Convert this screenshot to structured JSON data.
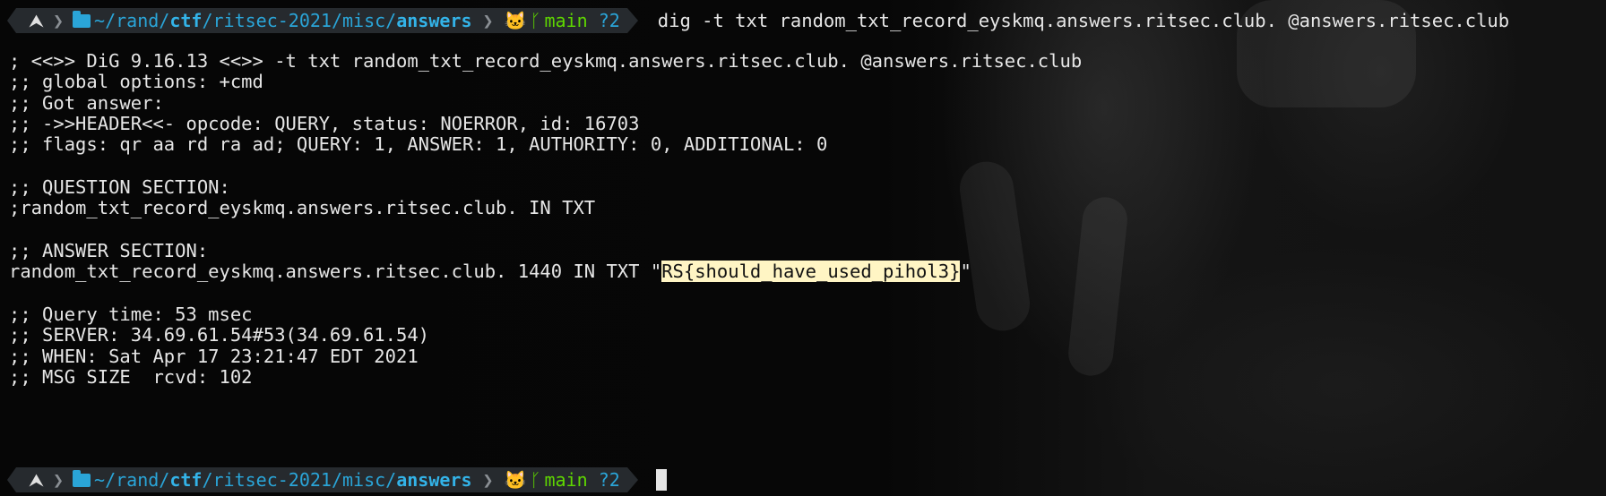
{
  "prompt": {
    "os_icon": "⮝",
    "path_prefix": "~/rand/",
    "path_ctf": "ctf",
    "path_mid": "/ritsec-2021/misc/",
    "path_last": "answers",
    "github_icon": "github-cat-icon",
    "branch_symbol": "ᚴ",
    "branch": "main",
    "status": "?2"
  },
  "command": "dig -t txt random_txt_record_eyskmq.answers.ritsec.club. @answers.ritsec.club",
  "output": {
    "line1": "; <<>> DiG 9.16.13 <<>> -t txt random_txt_record_eyskmq.answers.ritsec.club. @answers.ritsec.club",
    "line2": ";; global options: +cmd",
    "line3": ";; Got answer:",
    "line4": ";; ->>HEADER<<- opcode: QUERY, status: NOERROR, id: 16703",
    "line5": ";; flags: qr aa rd ra ad; QUERY: 1, ANSWER: 1, AUTHORITY: 0, ADDITIONAL: 0",
    "line6": ";; QUESTION SECTION:",
    "line7": ";random_txt_record_eyskmq.answers.ritsec.club. IN TXT",
    "line8": ";; ANSWER SECTION:",
    "answer_prefix": "random_txt_record_eyskmq.answers.ritsec.club. 1440 IN TXT \"",
    "answer_flag": "RS{should_have_used_pihol3}",
    "answer_suffix": "\"",
    "line10": ";; Query time: 53 msec",
    "line11": ";; SERVER: 34.69.61.54#53(34.69.61.54)",
    "line12": ";; WHEN: Sat Apr 17 23:21:47 EDT 2021",
    "line13": ";; MSG SIZE  rcvd: 102"
  }
}
